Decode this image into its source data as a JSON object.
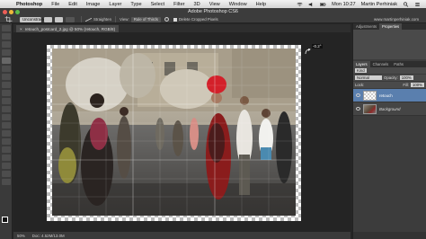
{
  "menubar": {
    "app": "Photoshop",
    "items": [
      "File",
      "Edit",
      "Image",
      "Layer",
      "Type",
      "Select",
      "Filter",
      "3D",
      "View",
      "Window",
      "Help"
    ],
    "clock": "Mon 10:27",
    "user": "Martin Perhiniak"
  },
  "window": {
    "title": "Adobe Photoshop CS6",
    "crop_ratio": "Unconstrained",
    "straighten_label": "Straighten",
    "view_label": "View:",
    "view_value": "Rule of Thirds",
    "delete_cropped_label": "Delete Cropped Pixels",
    "website": "www.martinperhiniak.com"
  },
  "document": {
    "tab_label": "retouch_postcard_2.jpg @ 50% (retouch, RGB/8)",
    "zoom": "50%",
    "doc_info": "Doc: 4.52M/13.0M",
    "angle": "-0.2°"
  },
  "panels": {
    "top_tabs": [
      "Adjustments",
      "Properties"
    ],
    "layer_tabs": [
      "Layers",
      "Channels",
      "Paths"
    ],
    "kind_label": "Kind",
    "blend_mode": "Normal",
    "opacity_label": "Opacity:",
    "opacity_value": "100%",
    "lock_label": "Lock:",
    "fill_label": "Fill:",
    "fill_value": "100%",
    "layers": [
      {
        "name": "retouch",
        "selected": true
      },
      {
        "name": "Background",
        "selected": false
      }
    ]
  },
  "colors": {
    "selection": "#5a7fae",
    "panel": "#3c3c3c"
  }
}
